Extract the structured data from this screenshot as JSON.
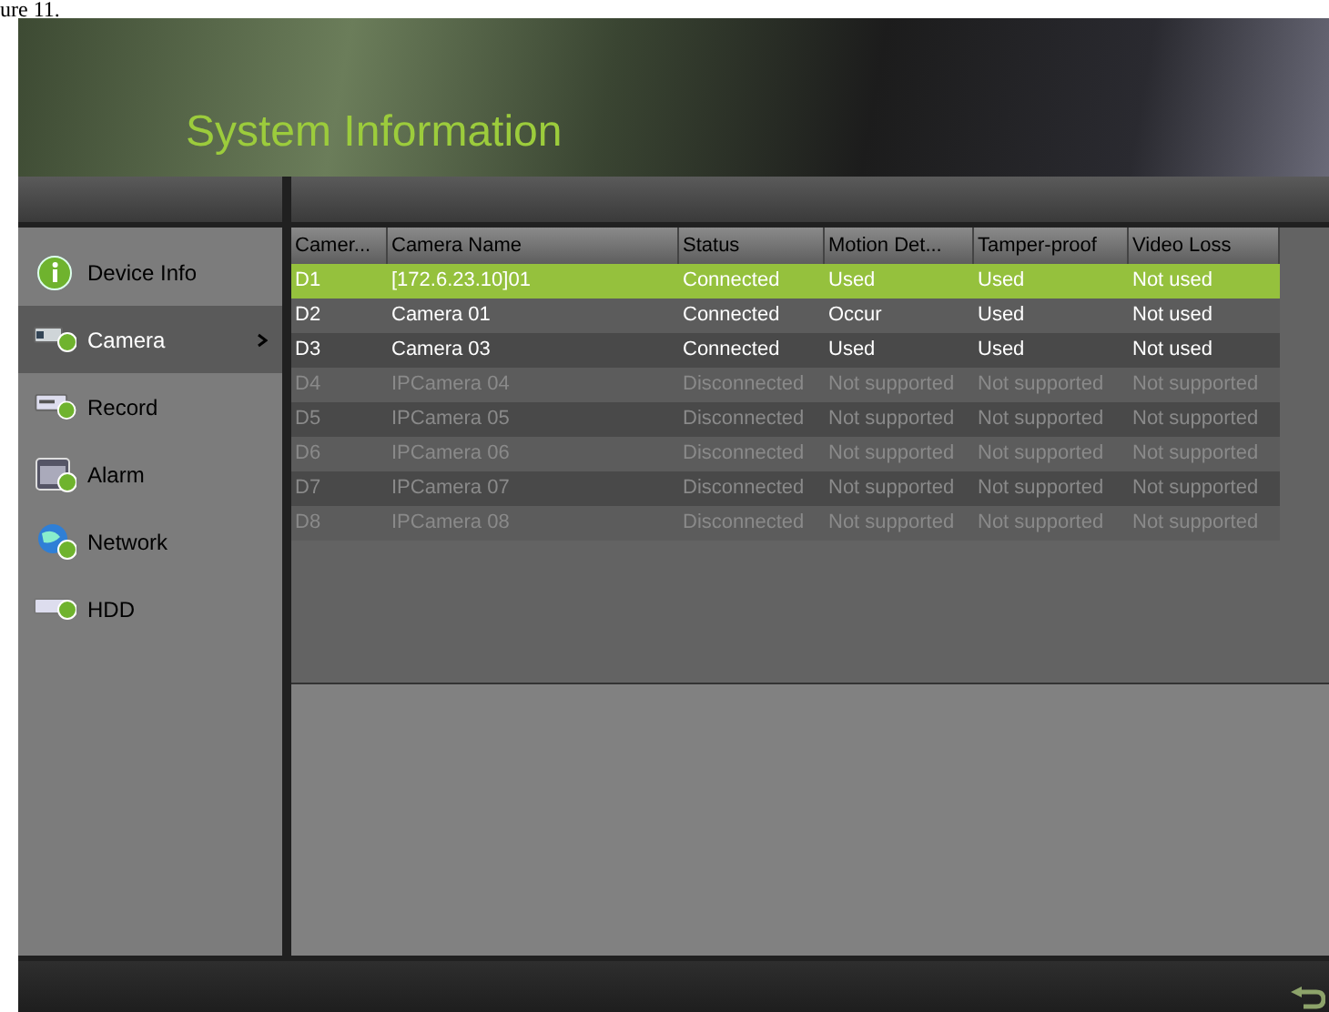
{
  "caption": "ure 11.",
  "window": {
    "title": "System Information"
  },
  "sidebar": {
    "items": [
      {
        "label": "Device Info",
        "kind": "info",
        "selected": false
      },
      {
        "label": "Camera",
        "kind": "camera",
        "selected": true
      },
      {
        "label": "Record",
        "kind": "record",
        "selected": false
      },
      {
        "label": "Alarm",
        "kind": "alarm",
        "selected": false
      },
      {
        "label": "Network",
        "kind": "network",
        "selected": false
      },
      {
        "label": "HDD",
        "kind": "hdd",
        "selected": false
      }
    ]
  },
  "table": {
    "columns": [
      "Camer...",
      "Camera Name",
      "Status",
      "Motion Det...",
      "Tamper-proof",
      "Video Loss"
    ],
    "rows": [
      {
        "cells": [
          "D1",
          "[172.6.23.10]01",
          "Connected",
          "Used",
          "Used",
          "Not used"
        ],
        "selected": true,
        "disabled": false
      },
      {
        "cells": [
          "D2",
          "Camera 01",
          "Connected",
          "Occur",
          "Used",
          "Not used"
        ],
        "selected": false,
        "disabled": false
      },
      {
        "cells": [
          "D3",
          "Camera 03",
          "Connected",
          "Used",
          "Used",
          "Not used"
        ],
        "selected": false,
        "disabled": false
      },
      {
        "cells": [
          "D4",
          "IPCamera 04",
          "Disconnected",
          "Not supported",
          "Not supported",
          "Not supported"
        ],
        "selected": false,
        "disabled": true
      },
      {
        "cells": [
          "D5",
          "IPCamera 05",
          "Disconnected",
          "Not supported",
          "Not supported",
          "Not supported"
        ],
        "selected": false,
        "disabled": true
      },
      {
        "cells": [
          "D6",
          "IPCamera 06",
          "Disconnected",
          "Not supported",
          "Not supported",
          "Not supported"
        ],
        "selected": false,
        "disabled": true
      },
      {
        "cells": [
          "D7",
          "IPCamera 07",
          "Disconnected",
          "Not supported",
          "Not supported",
          "Not supported"
        ],
        "selected": false,
        "disabled": true
      },
      {
        "cells": [
          "D8",
          "IPCamera 08",
          "Disconnected",
          "Not supported",
          "Not supported",
          "Not supported"
        ],
        "selected": false,
        "disabled": true
      }
    ]
  }
}
